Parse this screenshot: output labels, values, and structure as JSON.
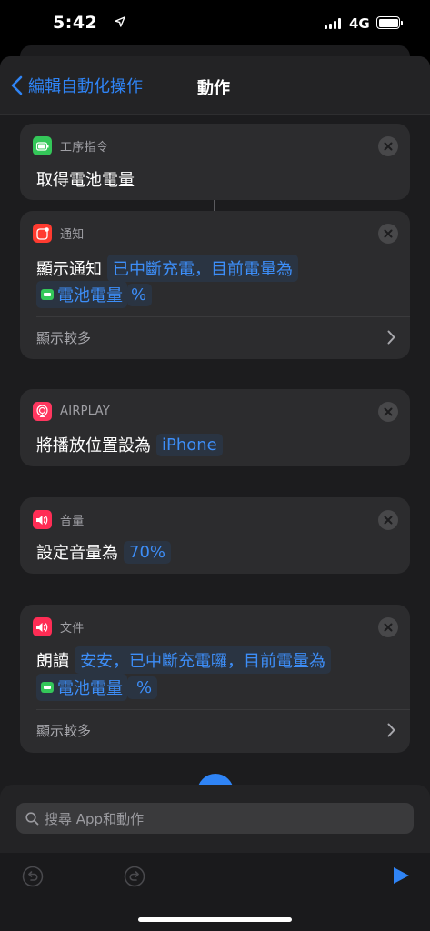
{
  "status_bar": {
    "time": "5:42",
    "network": "4G"
  },
  "nav": {
    "back_label": "編輯自動化操作",
    "title": "動作"
  },
  "cards": [
    {
      "app": "工序指令",
      "action": "取得電池電量"
    },
    {
      "app": "通知",
      "action": "顯示通知",
      "text_token": "已中斷充電，目前電量為",
      "var_token": "電池電量",
      "suffix_token": "%",
      "more": "顯示較多"
    },
    {
      "app": "AIRPLAY",
      "action": "將播放位置設為",
      "value_token": "iPhone"
    },
    {
      "app": "音量",
      "action": "設定音量為",
      "value_token": "70%"
    },
    {
      "app": "文件",
      "action": "朗讀",
      "text_token": "安安，已中斷充電囉，目前電量為",
      "var_token": "電池電量",
      "suffix_token": "%",
      "more": "顯示較多"
    }
  ],
  "search": {
    "placeholder": "搜尋 App和動作"
  },
  "colors": {
    "accent": "#2f84f6",
    "shortcuts_green": "#34c759",
    "notify_red": "#ff3b30",
    "airplay_red": "#ff375f",
    "volume_red": "#ff2d55"
  },
  "icons": [
    "location-arrow-icon",
    "signal-icon",
    "battery-icon",
    "chevron-left-icon",
    "close-icon",
    "chevron-right-icon",
    "search-icon",
    "undo-icon",
    "redo-icon",
    "play-icon"
  ]
}
